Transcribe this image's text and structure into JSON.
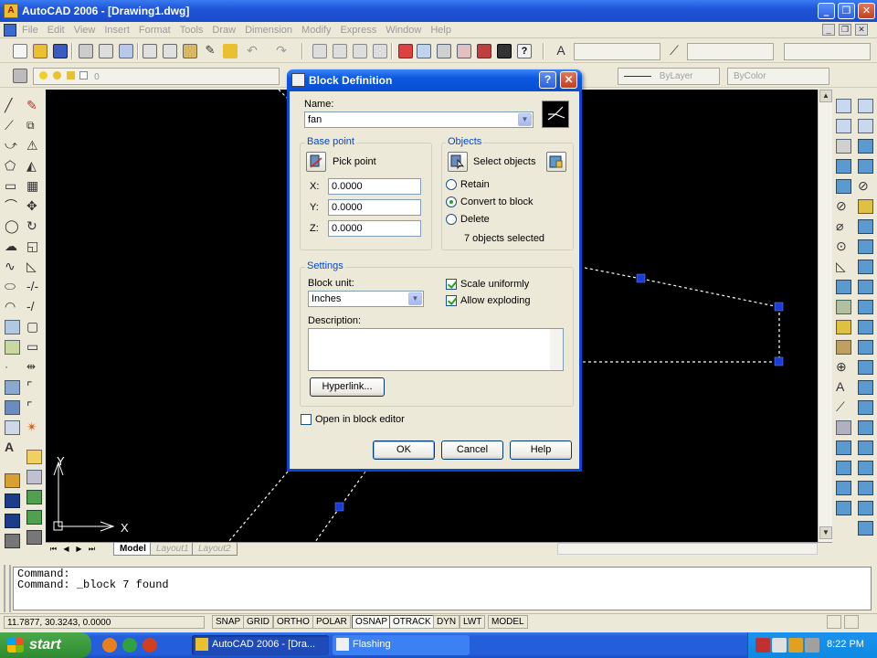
{
  "app": {
    "title": "AutoCAD 2006 - [Drawing1.dwg]",
    "window_buttons": [
      "_",
      "❐",
      "✕"
    ]
  },
  "menu": {
    "items": [
      "File",
      "Edit",
      "View",
      "Insert",
      "Format",
      "Tools",
      "Draw",
      "Dimension",
      "Modify",
      "Express",
      "Window",
      "Help"
    ],
    "mdi_buttons": [
      "_",
      "❐",
      "✕"
    ]
  },
  "properties_toolbar": {
    "layer_value": "0",
    "linetype_value": "ByLayer",
    "color_value": "ByColor"
  },
  "layout_tabs": {
    "tabs": [
      "Model",
      "Layout1",
      "Layout2"
    ]
  },
  "ucs": {
    "x_label": "X",
    "y_label": "Y"
  },
  "dialog": {
    "title": "Block Definition",
    "name_label": "Name:",
    "name_value": "fan",
    "base_point": {
      "title": "Base point",
      "pick_label": "Pick point",
      "x_label": "X:",
      "x_value": "0.0000",
      "y_label": "Y:",
      "y_value": "0.0000",
      "z_label": "Z:",
      "z_value": "0.0000"
    },
    "objects": {
      "title": "Objects",
      "select_label": "Select objects",
      "retain_label": "Retain",
      "convert_label": "Convert to block",
      "delete_label": "Delete",
      "selected_value": "Convert to block",
      "count_text": "7 objects selected"
    },
    "settings": {
      "title": "Settings",
      "block_unit_label": "Block unit:",
      "block_unit_value": "Inches",
      "scale_uniformly_label": "Scale uniformly",
      "scale_uniformly_checked": true,
      "allow_exploding_label": "Allow exploding",
      "allow_exploding_checked": true,
      "description_label": "Description:",
      "description_value": "",
      "hyperlink_label": "Hyperlink..."
    },
    "open_in_editor_label": "Open in block editor",
    "open_in_editor_checked": false,
    "ok_label": "OK",
    "cancel_label": "Cancel",
    "help_label": "Help"
  },
  "command": {
    "lines": [
      "Command:",
      "Command:  _block 7 found"
    ]
  },
  "status": {
    "coords": "11.7877, 30.3243, 0.0000",
    "buttons": [
      "SNAP",
      "GRID",
      "ORTHO",
      "POLAR",
      "OSNAP",
      "OTRACK",
      "DYN",
      "LWT",
      "MODEL"
    ]
  },
  "taskbar": {
    "start_label": "start",
    "tasks": [
      "AutoCAD 2006 - [Dra...",
      "Flashing"
    ],
    "clock": "8:22 PM"
  },
  "colors": {
    "xp_blue": "#245edb",
    "grip_blue": "#1a3cd8",
    "group_title": "#0046d5"
  }
}
